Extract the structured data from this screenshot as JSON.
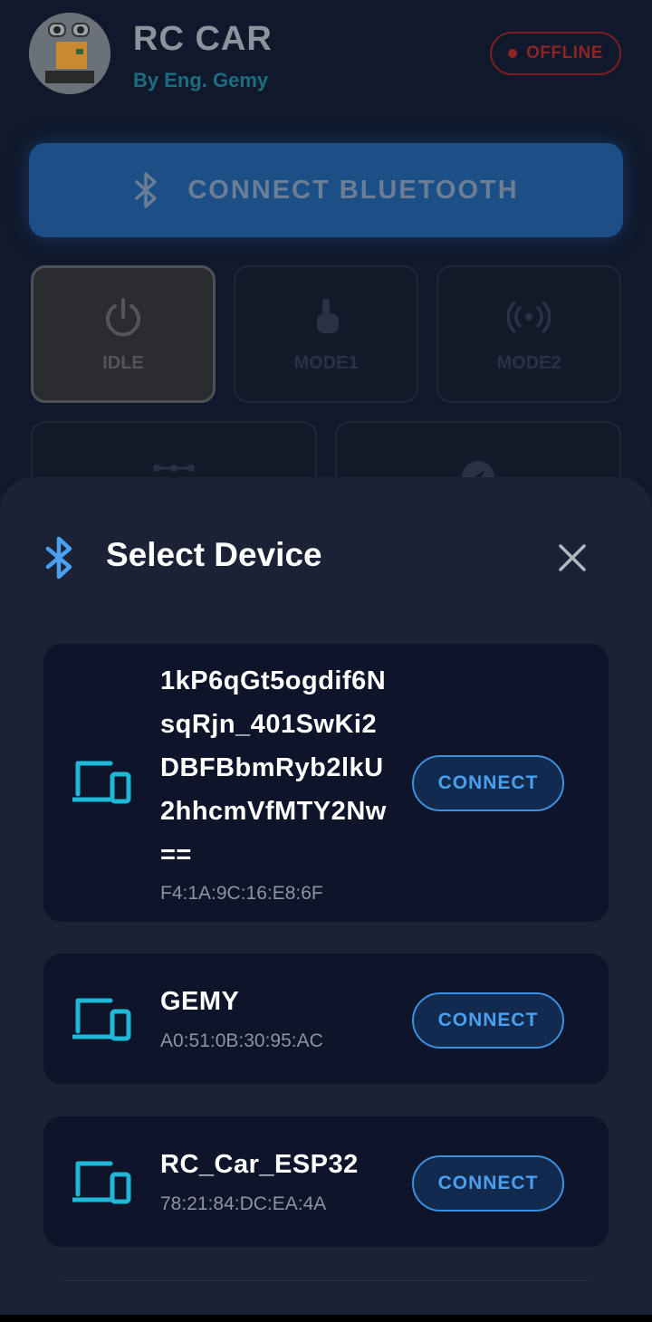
{
  "header": {
    "title": "RC CAR",
    "subtitle": "By Eng. Gemy",
    "status": "OFFLINE",
    "status_color": "#8f2424"
  },
  "bluetooth_button": {
    "label": "CONNECT BLUETOOTH",
    "icon": "bluetooth-icon"
  },
  "modes": [
    {
      "label": "IDLE",
      "icon": "power-icon",
      "active": true
    },
    {
      "label": "MODE1",
      "icon": "touch-icon",
      "active": false
    },
    {
      "label": "MODE2",
      "icon": "wireless-icon",
      "active": false
    }
  ],
  "sheet": {
    "title": "Select Device",
    "icon": "bluetooth-icon",
    "accent": "#4aa0f0",
    "devices": [
      {
        "name": "1kP6qGt5ogdif6NsqRjn_401SwKi2DBFBbmRyb2lkU2hhcmVfMTY2Nw==",
        "mac": "F4:1A:9C:16:E8:6F",
        "button": "CONNECT"
      },
      {
        "name": "GEMY",
        "mac": "A0:51:0B:30:95:AC",
        "button": "CONNECT"
      },
      {
        "name": "RC_Car_ESP32",
        "mac": "78:21:84:DC:EA:4A",
        "button": "CONNECT"
      }
    ]
  }
}
